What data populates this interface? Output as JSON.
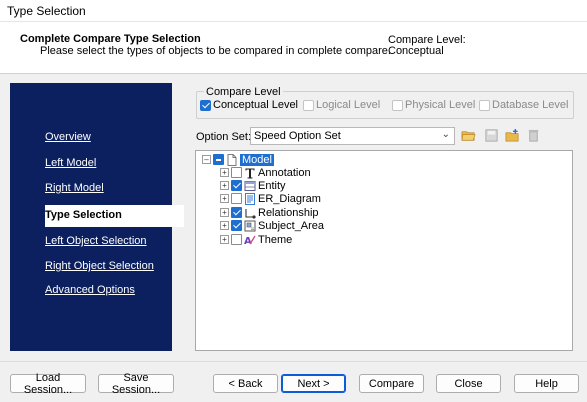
{
  "window": {
    "title": "Type Selection"
  },
  "header": {
    "title": "Complete Compare Type Selection",
    "description": "Please select the types of objects to be compared in complete compare.",
    "level_label": "Compare Level:",
    "level_value": "Conceptual"
  },
  "nav": {
    "items": [
      {
        "label": "Overview"
      },
      {
        "label": "Left Model"
      },
      {
        "label": "Right Model"
      },
      {
        "label": "Type Selection",
        "active": true
      },
      {
        "label": "Left Object Selection"
      },
      {
        "label": "Right Object Selection"
      },
      {
        "label": "Advanced Options"
      }
    ]
  },
  "compare_level": {
    "legend": "Compare Level",
    "options": [
      {
        "label": "Conceptual Level",
        "checked": true,
        "enabled": true
      },
      {
        "label": "Logical Level",
        "checked": false,
        "enabled": false
      },
      {
        "label": "Physical Level",
        "checked": false,
        "enabled": false
      },
      {
        "label": "Database Level",
        "checked": false,
        "enabled": false
      }
    ]
  },
  "option_set": {
    "label": "Option Set:",
    "value": "Speed Option Set",
    "toolbar_icons": [
      "open-folder-icon",
      "save-icon",
      "new-folder-icon",
      "delete-icon"
    ]
  },
  "tree": {
    "root": {
      "label": "Model",
      "state": "partial",
      "icon": "document-icon"
    },
    "children": [
      {
        "label": "Annotation",
        "checked": false,
        "icon": "text-annotation-icon"
      },
      {
        "label": "Entity",
        "checked": true,
        "icon": "entity-icon"
      },
      {
        "label": "ER_Diagram",
        "checked": false,
        "icon": "diagram-icon"
      },
      {
        "label": "Relationship",
        "checked": true,
        "icon": "relationship-icon"
      },
      {
        "label": "Subject_Area",
        "checked": true,
        "icon": "subject-area-icon"
      },
      {
        "label": "Theme",
        "checked": false,
        "icon": "theme-icon"
      }
    ]
  },
  "buttons": {
    "load_session": "Load Session...",
    "save_session": "Save Session...",
    "back": "< Back",
    "next": "Next >",
    "compare": "Compare",
    "close": "Close",
    "help": "Help"
  },
  "colors": {
    "sidebar_bg": "#0c1f5e",
    "accent": "#1f6fd1",
    "dialog_bg": "#f0f0f0"
  }
}
